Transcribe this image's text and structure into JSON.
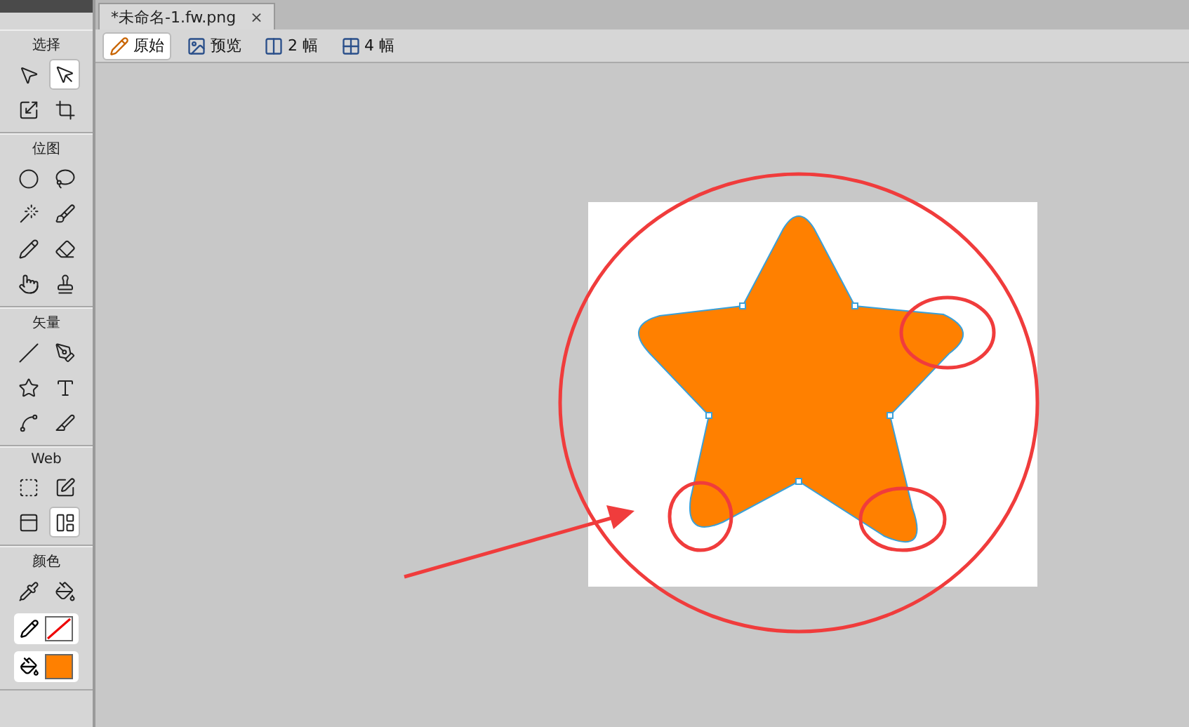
{
  "tools_panel": {
    "sections": [
      {
        "title": "选择",
        "tools": [
          {
            "selected": false
          },
          {
            "selected": true
          },
          {
            "selected": false
          },
          {
            "selected": false
          }
        ]
      },
      {
        "title": "位图",
        "tools": [
          {
            "selected": false
          },
          {
            "selected": false
          },
          {
            "selected": false
          },
          {
            "selected": false
          },
          {
            "selected": false
          },
          {
            "selected": false
          },
          {
            "selected": false
          },
          {
            "selected": false
          }
        ]
      },
      {
        "title": "矢量",
        "tools": [
          {
            "selected": false
          },
          {
            "selected": false
          },
          {
            "selected": false
          },
          {
            "selected": false
          },
          {
            "selected": false
          },
          {
            "selected": false
          }
        ]
      },
      {
        "title": "Web",
        "tools": [
          {
            "selected": false
          },
          {
            "selected": false
          },
          {
            "selected": false
          },
          {
            "selected": true
          }
        ]
      },
      {
        "title": "颜色",
        "tools": [
          {
            "selected": false
          },
          {
            "selected": false
          }
        ]
      }
    ],
    "swatches": [
      {
        "kind": "none"
      },
      {
        "kind": "solid",
        "color": "#ff8000"
      }
    ]
  },
  "document_tab": {
    "title": "*未命名-1.fw.png",
    "close": "×"
  },
  "view_buttons": [
    {
      "label": "原始",
      "selected": true
    },
    {
      "label": "预览",
      "selected": false
    },
    {
      "label": "2 幅",
      "selected": false
    },
    {
      "label": "4 幅",
      "selected": false
    }
  ]
}
